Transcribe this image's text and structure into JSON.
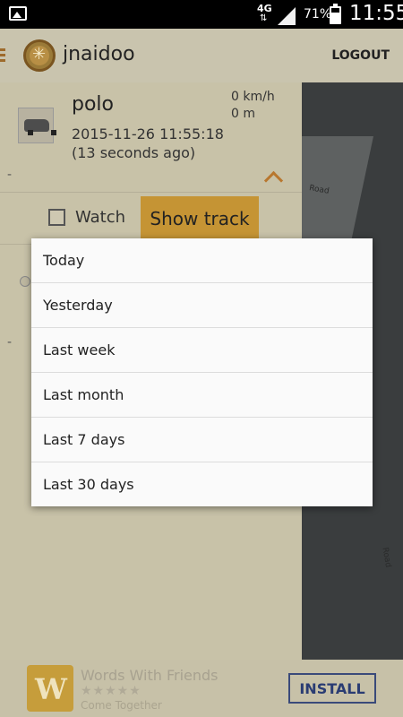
{
  "status_bar": {
    "network": "4G",
    "battery_percent": "71%",
    "battery_level": 0.71,
    "time": "11:55"
  },
  "app_bar": {
    "username": "jnaidoo",
    "logout_label": "LOGOUT"
  },
  "vehicle": {
    "name": "polo",
    "timestamp": "2015-11-26 11:55:18",
    "ago": "(13 seconds ago)",
    "speed": "0 km/h",
    "distance": "0 m",
    "dash_a": "-",
    "dash_b": "-"
  },
  "controls": {
    "watch_label": "Watch",
    "show_track_label": "Show track"
  },
  "map": {
    "road_label": "Road",
    "road_label_2": "Road"
  },
  "menu": {
    "items": [
      "Today",
      "Yesterday",
      "Last week",
      "Last month",
      "Last 7 days",
      "Last 30 days"
    ]
  },
  "ad": {
    "icon_letter": "W",
    "title": "Words With Friends",
    "stars": "★★★★★",
    "subtitle": "Come Together",
    "install_label": "INSTALL"
  },
  "colors": {
    "accent": "#c59434",
    "overlay_bg": "#c8c2a8",
    "menu_bg": "#fafafa"
  }
}
